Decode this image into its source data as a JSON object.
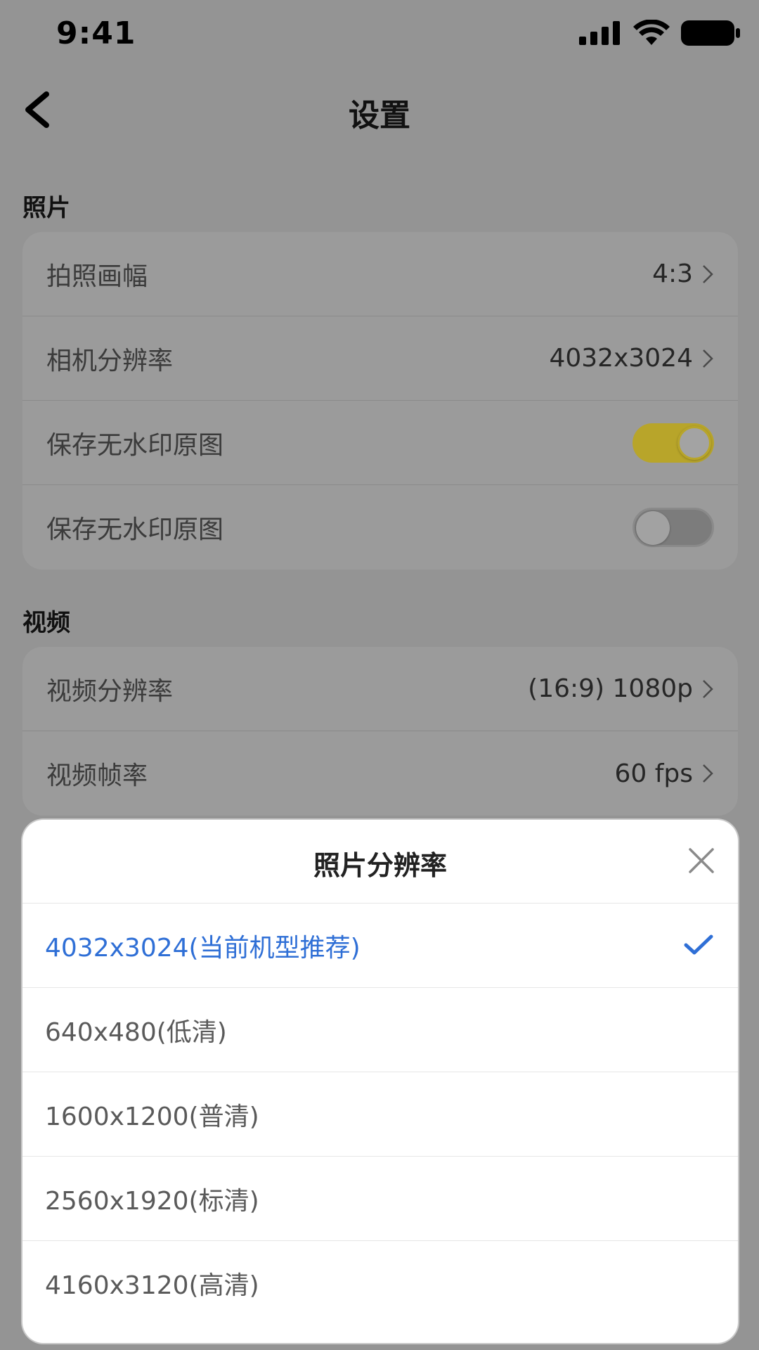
{
  "status_bar": {
    "time": "9:41"
  },
  "nav": {
    "title": "设置"
  },
  "sections": {
    "photo": {
      "title": "照片",
      "rows": [
        {
          "label": "拍照画幅",
          "value": "4:3"
        },
        {
          "label": "相机分辨率",
          "value": "4032x3024"
        },
        {
          "label": "保存无水印原图",
          "toggle": "on"
        },
        {
          "label": "保存无水印原图",
          "toggle": "off"
        }
      ]
    },
    "video": {
      "title": "视频",
      "rows": [
        {
          "label": "视频分辨率",
          "value": "(16:9) 1080p"
        },
        {
          "label": "视频帧率",
          "value": "60 fps"
        }
      ]
    }
  },
  "sheet": {
    "title": "照片分辨率",
    "options": [
      {
        "label": "4032x3024(当前机型推荐)",
        "selected": true
      },
      {
        "label": "640x480(低清)",
        "selected": false
      },
      {
        "label": "1600x1200(普清)",
        "selected": false
      },
      {
        "label": "2560x1920(标清)",
        "selected": false
      },
      {
        "label": "4160x3120(高清)",
        "selected": false
      }
    ]
  },
  "colors": {
    "accent_blue": "#2f6fd6",
    "toggle_on": "#b8a52a",
    "overlay_gray": "#949494"
  },
  "icons": {
    "back": "chevron-left-icon",
    "close": "close-icon",
    "check": "checkmark-icon",
    "row_chevron": "chevron-right-icon"
  }
}
